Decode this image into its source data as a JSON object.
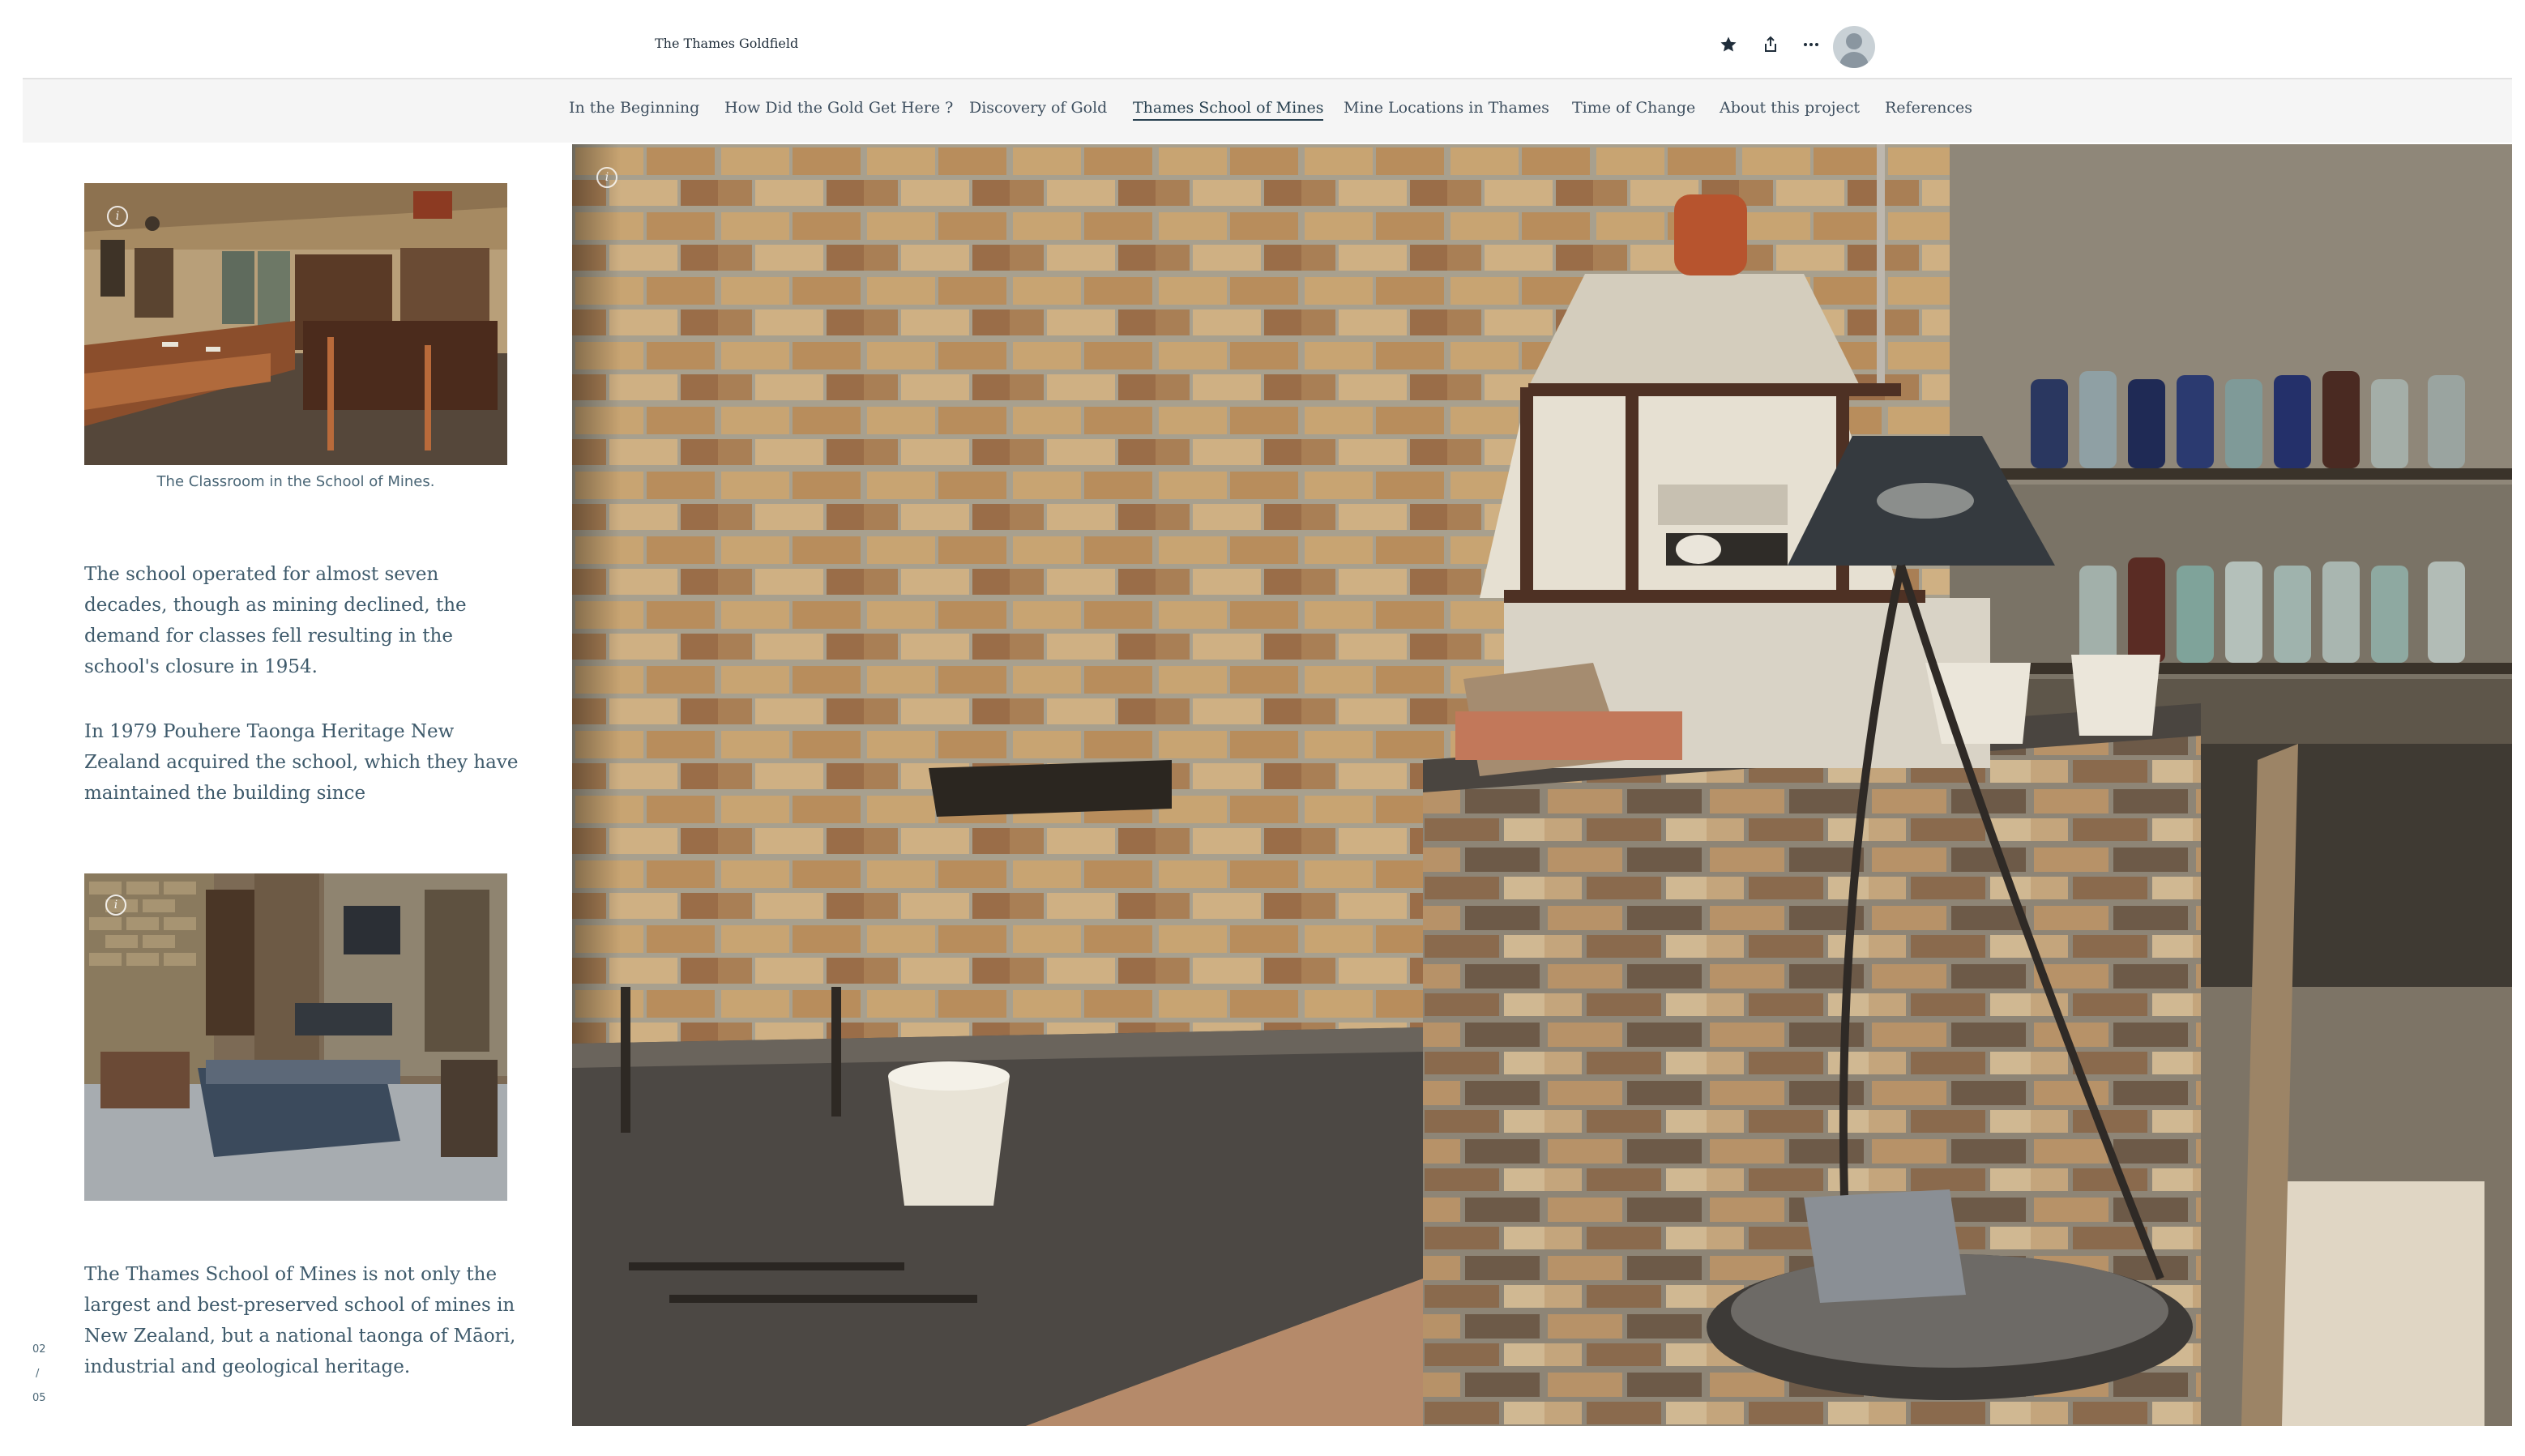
{
  "header": {
    "site_title": "The Thames Goldfield",
    "icons": [
      "star-icon",
      "share-icon",
      "more-icon",
      "avatar"
    ]
  },
  "nav": {
    "items": [
      {
        "label": "In the Beginning",
        "active": false
      },
      {
        "label": "How Did the Gold Get Here ?",
        "active": false
      },
      {
        "label": "Discovery of Gold",
        "active": false
      },
      {
        "label": "Thames School of Mines",
        "active": true
      },
      {
        "label": "Mine Locations in Thames",
        "active": false
      },
      {
        "label": "Time of Change",
        "active": false
      },
      {
        "label": "About this project",
        "active": false
      },
      {
        "label": "References",
        "active": false
      }
    ]
  },
  "left": {
    "classroom_caption": "The Classroom in the School of Mines.",
    "para1": "The school operated for almost seven decades, though as mining declined, the demand for classes fell resulting in the school's closure in 1954.",
    "para2": "In 1979 Pouhere Taonga Heritage New Zealand acquired the school, which they have maintained the building since",
    "para3": "The Thames School of Mines is not only the largest and best-preserved school of mines in New Zealand, but a national taonga of Māori, industrial and geological heritage."
  },
  "pager": {
    "current": "02",
    "separator": "/",
    "total": "05"
  },
  "colors": {
    "accent": "#27404f",
    "nav_bg": "#f5f5f5",
    "text": "#3e5a6b"
  }
}
